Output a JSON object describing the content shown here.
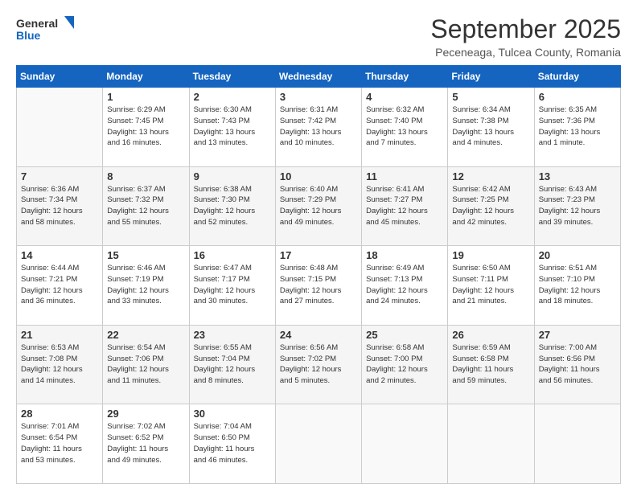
{
  "header": {
    "logo_general": "General",
    "logo_blue": "Blue",
    "month_title": "September 2025",
    "location": "Peceneaga, Tulcea County, Romania"
  },
  "weekdays": [
    "Sunday",
    "Monday",
    "Tuesday",
    "Wednesday",
    "Thursday",
    "Friday",
    "Saturday"
  ],
  "weeks": [
    [
      {
        "day": "",
        "info": ""
      },
      {
        "day": "1",
        "info": "Sunrise: 6:29 AM\nSunset: 7:45 PM\nDaylight: 13 hours\nand 16 minutes."
      },
      {
        "day": "2",
        "info": "Sunrise: 6:30 AM\nSunset: 7:43 PM\nDaylight: 13 hours\nand 13 minutes."
      },
      {
        "day": "3",
        "info": "Sunrise: 6:31 AM\nSunset: 7:42 PM\nDaylight: 13 hours\nand 10 minutes."
      },
      {
        "day": "4",
        "info": "Sunrise: 6:32 AM\nSunset: 7:40 PM\nDaylight: 13 hours\nand 7 minutes."
      },
      {
        "day": "5",
        "info": "Sunrise: 6:34 AM\nSunset: 7:38 PM\nDaylight: 13 hours\nand 4 minutes."
      },
      {
        "day": "6",
        "info": "Sunrise: 6:35 AM\nSunset: 7:36 PM\nDaylight: 13 hours\nand 1 minute."
      }
    ],
    [
      {
        "day": "7",
        "info": "Sunrise: 6:36 AM\nSunset: 7:34 PM\nDaylight: 12 hours\nand 58 minutes."
      },
      {
        "day": "8",
        "info": "Sunrise: 6:37 AM\nSunset: 7:32 PM\nDaylight: 12 hours\nand 55 minutes."
      },
      {
        "day": "9",
        "info": "Sunrise: 6:38 AM\nSunset: 7:30 PM\nDaylight: 12 hours\nand 52 minutes."
      },
      {
        "day": "10",
        "info": "Sunrise: 6:40 AM\nSunset: 7:29 PM\nDaylight: 12 hours\nand 49 minutes."
      },
      {
        "day": "11",
        "info": "Sunrise: 6:41 AM\nSunset: 7:27 PM\nDaylight: 12 hours\nand 45 minutes."
      },
      {
        "day": "12",
        "info": "Sunrise: 6:42 AM\nSunset: 7:25 PM\nDaylight: 12 hours\nand 42 minutes."
      },
      {
        "day": "13",
        "info": "Sunrise: 6:43 AM\nSunset: 7:23 PM\nDaylight: 12 hours\nand 39 minutes."
      }
    ],
    [
      {
        "day": "14",
        "info": "Sunrise: 6:44 AM\nSunset: 7:21 PM\nDaylight: 12 hours\nand 36 minutes."
      },
      {
        "day": "15",
        "info": "Sunrise: 6:46 AM\nSunset: 7:19 PM\nDaylight: 12 hours\nand 33 minutes."
      },
      {
        "day": "16",
        "info": "Sunrise: 6:47 AM\nSunset: 7:17 PM\nDaylight: 12 hours\nand 30 minutes."
      },
      {
        "day": "17",
        "info": "Sunrise: 6:48 AM\nSunset: 7:15 PM\nDaylight: 12 hours\nand 27 minutes."
      },
      {
        "day": "18",
        "info": "Sunrise: 6:49 AM\nSunset: 7:13 PM\nDaylight: 12 hours\nand 24 minutes."
      },
      {
        "day": "19",
        "info": "Sunrise: 6:50 AM\nSunset: 7:11 PM\nDaylight: 12 hours\nand 21 minutes."
      },
      {
        "day": "20",
        "info": "Sunrise: 6:51 AM\nSunset: 7:10 PM\nDaylight: 12 hours\nand 18 minutes."
      }
    ],
    [
      {
        "day": "21",
        "info": "Sunrise: 6:53 AM\nSunset: 7:08 PM\nDaylight: 12 hours\nand 14 minutes."
      },
      {
        "day": "22",
        "info": "Sunrise: 6:54 AM\nSunset: 7:06 PM\nDaylight: 12 hours\nand 11 minutes."
      },
      {
        "day": "23",
        "info": "Sunrise: 6:55 AM\nSunset: 7:04 PM\nDaylight: 12 hours\nand 8 minutes."
      },
      {
        "day": "24",
        "info": "Sunrise: 6:56 AM\nSunset: 7:02 PM\nDaylight: 12 hours\nand 5 minutes."
      },
      {
        "day": "25",
        "info": "Sunrise: 6:58 AM\nSunset: 7:00 PM\nDaylight: 12 hours\nand 2 minutes."
      },
      {
        "day": "26",
        "info": "Sunrise: 6:59 AM\nSunset: 6:58 PM\nDaylight: 11 hours\nand 59 minutes."
      },
      {
        "day": "27",
        "info": "Sunrise: 7:00 AM\nSunset: 6:56 PM\nDaylight: 11 hours\nand 56 minutes."
      }
    ],
    [
      {
        "day": "28",
        "info": "Sunrise: 7:01 AM\nSunset: 6:54 PM\nDaylight: 11 hours\nand 53 minutes."
      },
      {
        "day": "29",
        "info": "Sunrise: 7:02 AM\nSunset: 6:52 PM\nDaylight: 11 hours\nand 49 minutes."
      },
      {
        "day": "30",
        "info": "Sunrise: 7:04 AM\nSunset: 6:50 PM\nDaylight: 11 hours\nand 46 minutes."
      },
      {
        "day": "",
        "info": ""
      },
      {
        "day": "",
        "info": ""
      },
      {
        "day": "",
        "info": ""
      },
      {
        "day": "",
        "info": ""
      }
    ]
  ]
}
